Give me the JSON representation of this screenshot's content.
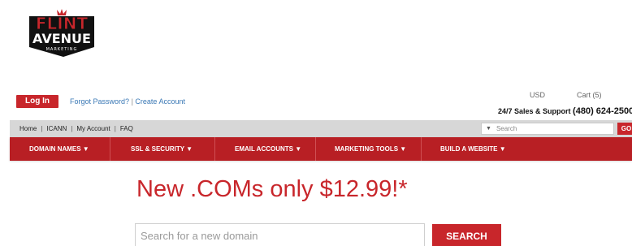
{
  "brand": {
    "logo_line1": "FLINT",
    "logo_line2": "AVENUE",
    "logo_line3": "MARKETING",
    "color_primary": "#c8262b"
  },
  "header": {
    "login_label": "Log In",
    "forgot_password": "Forgot Password?",
    "link_separator": "|",
    "create_account": "Create Account",
    "currency": "USD",
    "cart": "Cart (5)",
    "support_label": "24/7 Sales & Support",
    "support_phone": "(480) 624-2500"
  },
  "utility_nav": {
    "links": [
      "Home",
      "ICANN",
      "My Account",
      "FAQ"
    ],
    "search_caret": "▼",
    "search_placeholder": "Search",
    "go_label": "GO"
  },
  "main_nav": {
    "items": [
      "DOMAIN NAMES ▼",
      "SSL & SECURITY ▼",
      "EMAIL ACCOUNTS ▼",
      "MARKETING TOOLS ▼",
      "BUILD A WEBSITE ▼"
    ]
  },
  "promo": {
    "headline": "New .COMs only $12.99!*"
  },
  "domain_search": {
    "placeholder": "Search for a new domain",
    "button_label": "SEARCH"
  }
}
